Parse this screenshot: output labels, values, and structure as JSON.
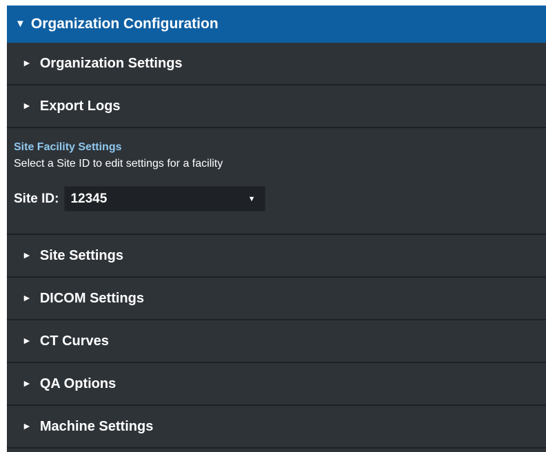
{
  "header": {
    "caret": "▼",
    "title": "Organization Configuration"
  },
  "top_sections": [
    {
      "caret": "►",
      "label": "Organization Settings"
    },
    {
      "caret": "►",
      "label": "Export Logs"
    }
  ],
  "site_facility": {
    "heading": "Site Facility Settings",
    "description": "Select a Site ID to edit settings for a facility",
    "site_id_label": "Site ID:",
    "site_id_value": "12345",
    "dropdown_icon": "▼"
  },
  "bottom_sections": [
    {
      "caret": "►",
      "label": "Site Settings"
    },
    {
      "caret": "►",
      "label": "DICOM Settings"
    },
    {
      "caret": "►",
      "label": "CT Curves"
    },
    {
      "caret": "►",
      "label": "QA Options"
    },
    {
      "caret": "►",
      "label": "Machine Settings"
    }
  ],
  "colors": {
    "header_bg": "#0e5fa2",
    "panel_bg": "#2e3338",
    "heading_accent": "#8fc8ee",
    "select_bg": "#1e2226"
  }
}
